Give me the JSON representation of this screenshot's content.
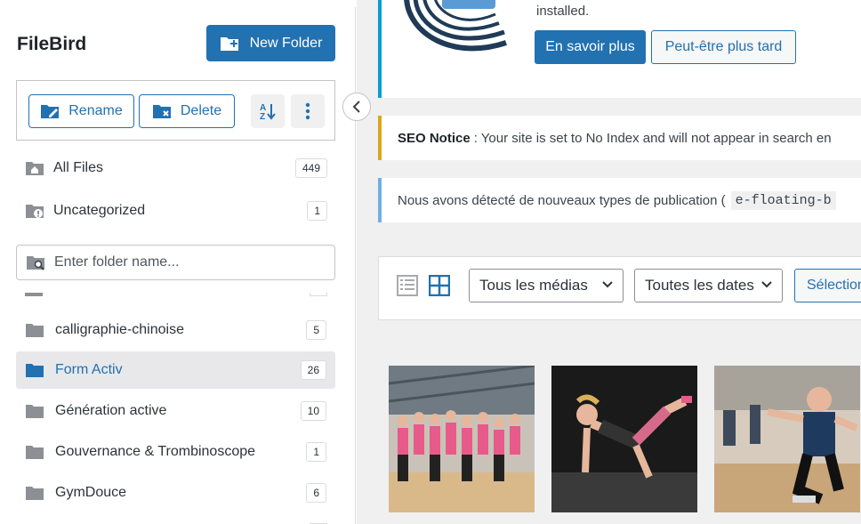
{
  "sidebar": {
    "title": "FileBird",
    "new_folder_label": "New Folder",
    "rename_label": "Rename",
    "delete_label": "Delete",
    "system_folders": [
      {
        "label": "All Files",
        "count": "449",
        "icon": "home-folder-icon"
      },
      {
        "label": "Uncategorized",
        "count": "1",
        "icon": "uncategorized-folder-icon"
      }
    ],
    "search_placeholder": "Enter folder name...",
    "folders": [
      {
        "label": "calligraphie-chinoise",
        "count": "5",
        "active": false
      },
      {
        "label": "Form Activ",
        "count": "26",
        "active": true
      },
      {
        "label": "Génération active",
        "count": "10",
        "active": false
      },
      {
        "label": "Gouvernance & Trombinoscope",
        "count": "1",
        "active": false
      },
      {
        "label": "GymDouce",
        "count": "6",
        "active": false
      }
    ]
  },
  "main": {
    "top_notice": {
      "text": "installed.",
      "primary_label": "En savoir plus",
      "secondary_label": "Peut-être plus tard"
    },
    "seo_notice": {
      "title": "SEO Notice",
      "text": ": Your site is set to No Index and will not appear in search en"
    },
    "post_type_notice": {
      "text": "Nous avons détecté de nouveaux types de publication (",
      "code": "e-floating-b"
    },
    "media_toolbar": {
      "filter_type": "Tous les médias",
      "filter_date": "Toutes les dates",
      "select_label": "Sélection"
    }
  },
  "colors": {
    "accent": "#2271b1",
    "warning": "#dba617",
    "info": "#72aee6",
    "active_bg": "#e8e8ea"
  }
}
